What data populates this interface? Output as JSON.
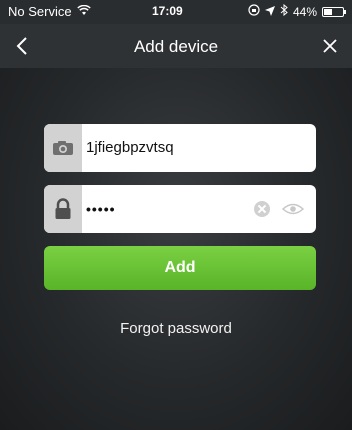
{
  "status_bar": {
    "carrier": "No Service",
    "time": "17:09",
    "battery": "44%",
    "battery_level": 0.44,
    "icons": [
      "wifi-icon",
      "rotation-lock-icon",
      "location-icon",
      "bluetooth-icon",
      "battery-icon"
    ]
  },
  "nav": {
    "title": "Add device",
    "back_icon": "chevron-left-icon",
    "close_icon": "close-icon"
  },
  "form": {
    "device_id": {
      "value": "1jfiegbpzvtsq",
      "icon": "camera-icon"
    },
    "password": {
      "value": "•••••",
      "icon": "lock-icon",
      "clear_icon": "clear-icon",
      "reveal_icon": "eye-icon"
    },
    "add_label": "Add",
    "forgot_label": "Forgot password"
  },
  "colors": {
    "accent_green": "#66c232",
    "nav_bg": "#2f3235"
  }
}
